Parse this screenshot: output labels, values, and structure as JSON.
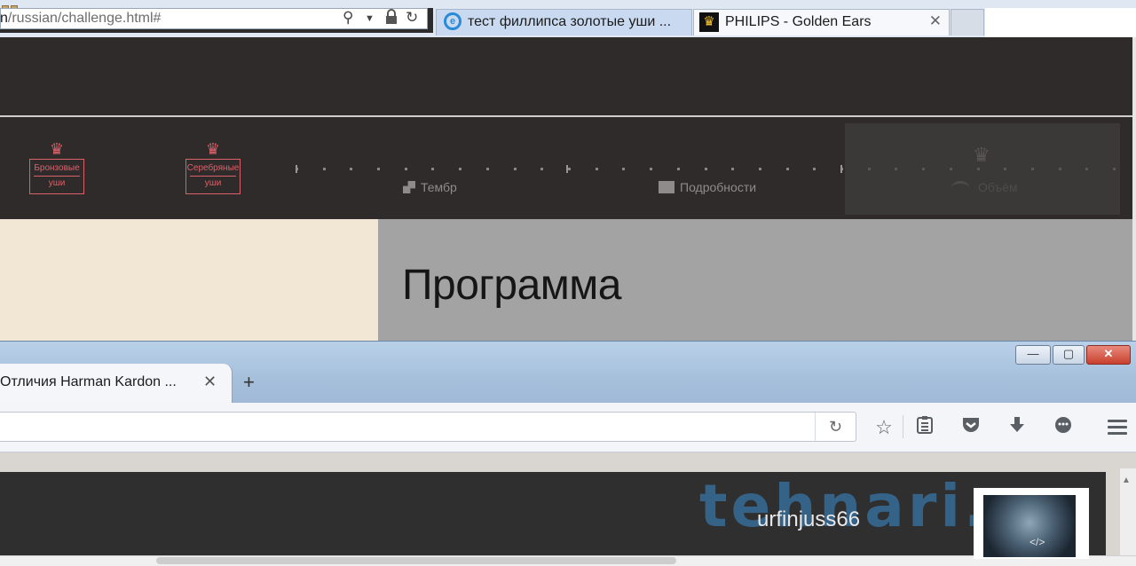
{
  "ie": {
    "address": {
      "prefix": "n",
      "path": "/russian/challenge.html#"
    },
    "tabs": [
      {
        "label": "тест филлипса золотые уши ..."
      },
      {
        "label": "PHILIPS - Golden Ears"
      }
    ],
    "close_glyph": "✕"
  },
  "site": {
    "badges": [
      {
        "line1": "Бронзовые",
        "line2": "уши"
      },
      {
        "line1": "Серебряные",
        "line2": "уши"
      }
    ],
    "nav": [
      {
        "label": "Тембр"
      },
      {
        "label": "Подробности"
      },
      {
        "label": "Объём"
      }
    ],
    "program_title": "Программа"
  },
  "firefox": {
    "tab_label": "Отличия Harman Kardon ...",
    "tab_close": "✕",
    "new_tab": "+",
    "window_buttons": {
      "minimize": "—",
      "maximize": "▢",
      "close": "✕"
    }
  },
  "video_overlay": {
    "watermark": "tehnari.ru",
    "username": "urfinjuss66"
  },
  "colors": {
    "site_dark": "#2f2b2b",
    "badge_accent": "#d9616a",
    "beige": "#f2e6d4",
    "grey_panel": "#a3a3a3",
    "watermark": "#3a82be"
  }
}
